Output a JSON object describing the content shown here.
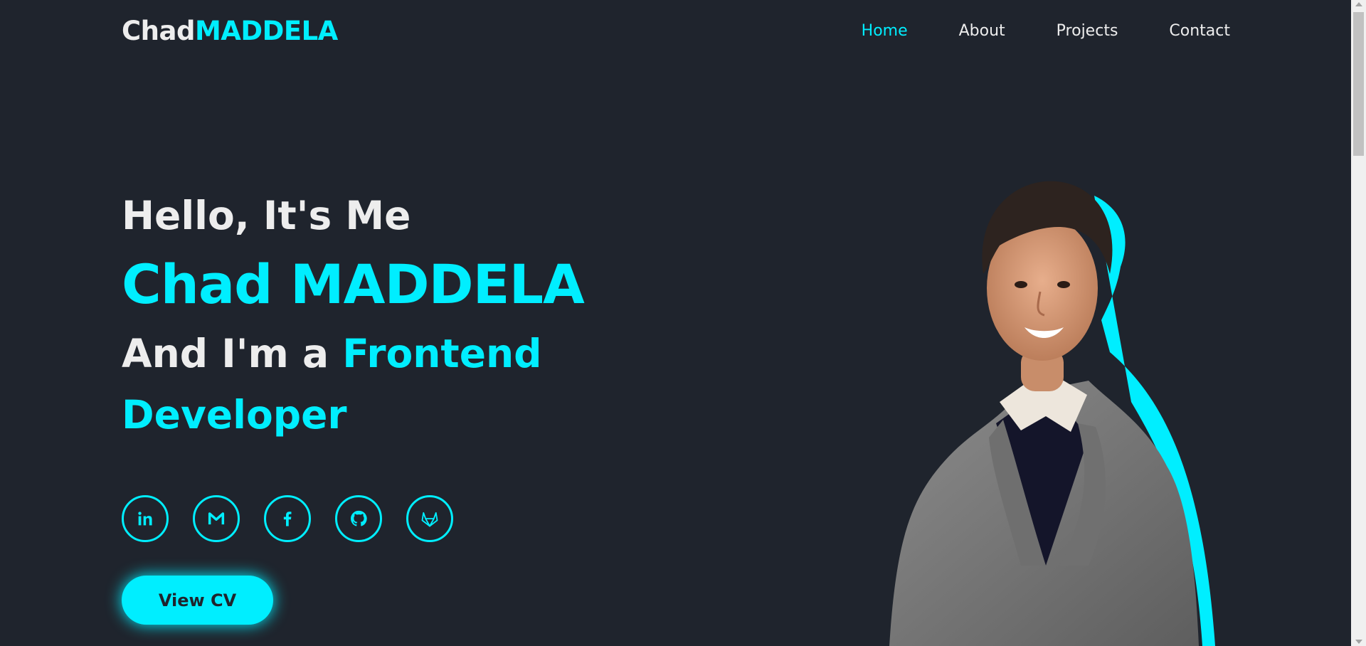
{
  "header": {
    "logo_first": "Chad",
    "logo_second": "MADDELA",
    "nav": [
      {
        "label": "Home",
        "active": true
      },
      {
        "label": "About",
        "active": false
      },
      {
        "label": "Projects",
        "active": false
      },
      {
        "label": "Contact",
        "active": false
      }
    ]
  },
  "hero": {
    "greeting": "Hello, It's Me",
    "name": "Chad MADDELA",
    "role_prefix": "And I'm a",
    "role_title_1": "Frontend",
    "role_title_2": "Developer"
  },
  "socials": [
    {
      "icon": "linkedin-icon"
    },
    {
      "icon": "gmail-icon"
    },
    {
      "icon": "facebook-icon"
    },
    {
      "icon": "github-icon"
    },
    {
      "icon": "gitlab-icon"
    }
  ],
  "cv_button": "View CV",
  "colors": {
    "background": "#1f242d",
    "accent": "#00eeff",
    "text": "#ededed"
  }
}
